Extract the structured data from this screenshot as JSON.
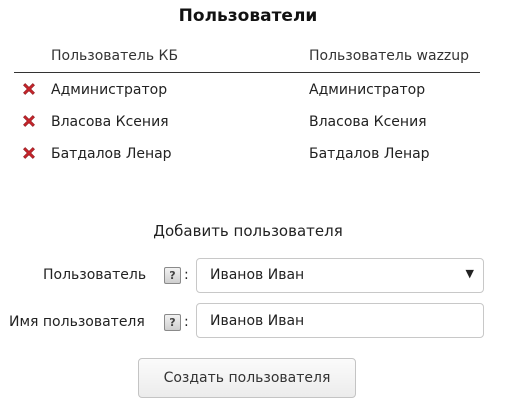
{
  "title": "Пользователи",
  "table": {
    "headers": {
      "kb_user": "Пользователь КБ",
      "wazzup_user": "Пользователь wazzup"
    },
    "rows": [
      {
        "kb_user": "Администратор",
        "wazzup_user": "Администратор",
        "delete_icon": "red-x-icon"
      },
      {
        "kb_user": "Власова Ксения",
        "wazzup_user": "Власова Ксения",
        "delete_icon": "red-x-icon"
      },
      {
        "kb_user": "Батдалов Ленар",
        "wazzup_user": "Батдалов Ленар",
        "delete_icon": "red-x-icon"
      }
    ]
  },
  "add_form": {
    "title": "Добавить пользователя",
    "user_field": {
      "label": "Пользователь",
      "help_glyph": "?",
      "colon": ":",
      "selected_value": "Иванов Иван",
      "arrow_glyph": "▼"
    },
    "name_field": {
      "label": "Имя пользователя",
      "help_glyph": "?",
      "colon": ":",
      "value": "Иванов Иван"
    },
    "submit_label": "Создать пользователя"
  },
  "colors": {
    "delete_icon": "#c8242b",
    "header_border": "#333333",
    "input_border": "#c8c8c8"
  }
}
